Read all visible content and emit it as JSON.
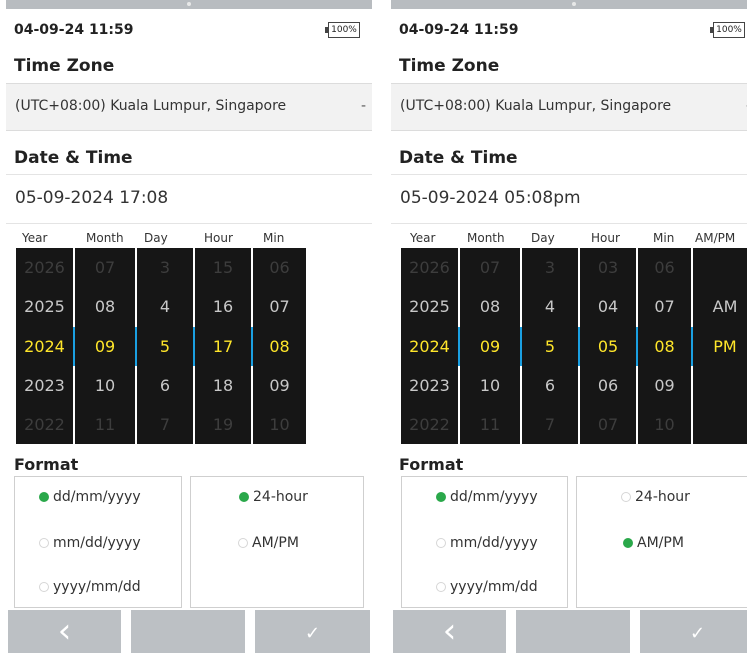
{
  "screens": [
    {
      "status": {
        "datetime": "04-09-24 11:59",
        "battery": "100%"
      },
      "timezone": {
        "title": "Time Zone",
        "value": "(UTC+08:00) Kuala Lumpur, Singapore",
        "dropdown": "-"
      },
      "datetime": {
        "title": "Date & Time",
        "value": "05-09-2024 17:08"
      },
      "picker": {
        "headers": [
          "Year",
          "Month",
          "Day",
          "Hour",
          "Min"
        ],
        "columns": [
          [
            "2026",
            "2025",
            "2024",
            "2023",
            "2022"
          ],
          [
            "07",
            "08",
            "09",
            "10",
            "11"
          ],
          [
            "3",
            "4",
            "5",
            "6",
            "7"
          ],
          [
            "15",
            "16",
            "17",
            "18",
            "19"
          ],
          [
            "06",
            "07",
            "08",
            "09",
            "10"
          ]
        ],
        "selected_index": 2
      },
      "format": {
        "title": "Format",
        "date_options": [
          {
            "label": "dd/mm/yyyy",
            "selected": true
          },
          {
            "label": "mm/dd/yyyy",
            "selected": false
          },
          {
            "label": "yyyy/mm/dd",
            "selected": false
          }
        ],
        "time_options": [
          {
            "label": "24-hour",
            "selected": true
          },
          {
            "label": "AM/PM",
            "selected": false
          }
        ]
      },
      "footer": {
        "back_icon": "chevron-left-icon",
        "back": "‹",
        "middle": "",
        "confirm_icon": "checkmark-icon",
        "confirm": "✓"
      }
    },
    {
      "status": {
        "datetime": "04-09-24 11:59",
        "battery": "100%"
      },
      "timezone": {
        "title": "Time Zone",
        "value": "(UTC+08:00) Kuala Lumpur, Singapore",
        "dropdown": "-"
      },
      "datetime": {
        "title": "Date & Time",
        "value": "05-09-2024 05:08pm"
      },
      "picker": {
        "headers": [
          "Year",
          "Month",
          "Day",
          "Hour",
          "Min",
          "AM/PM"
        ],
        "columns": [
          [
            "2026",
            "2025",
            "2024",
            "2023",
            "2022"
          ],
          [
            "07",
            "08",
            "09",
            "10",
            "11"
          ],
          [
            "3",
            "4",
            "5",
            "6",
            "7"
          ],
          [
            "03",
            "04",
            "05",
            "06",
            "07"
          ],
          [
            "06",
            "07",
            "08",
            "09",
            "10"
          ],
          [
            "",
            "AM",
            "PM",
            "",
            ""
          ]
        ],
        "selected_index": 2
      },
      "format": {
        "title": "Format",
        "date_options": [
          {
            "label": "dd/mm/yyyy",
            "selected": true
          },
          {
            "label": "mm/dd/yyyy",
            "selected": false
          },
          {
            "label": "yyyy/mm/dd",
            "selected": false
          }
        ],
        "time_options": [
          {
            "label": "24-hour",
            "selected": false
          },
          {
            "label": "AM/PM",
            "selected": true
          }
        ]
      },
      "footer": {
        "back_icon": "chevron-left-icon",
        "back": "‹",
        "middle": "",
        "confirm_icon": "checkmark-icon",
        "confirm": "✓"
      }
    }
  ],
  "colors": {
    "selection_bar": "#1ba0e2",
    "selected_text": "#ffe62a",
    "wheel_bg": "#161616",
    "radio_on": "#2aa84a",
    "footer_button": "#bcc0c4"
  }
}
